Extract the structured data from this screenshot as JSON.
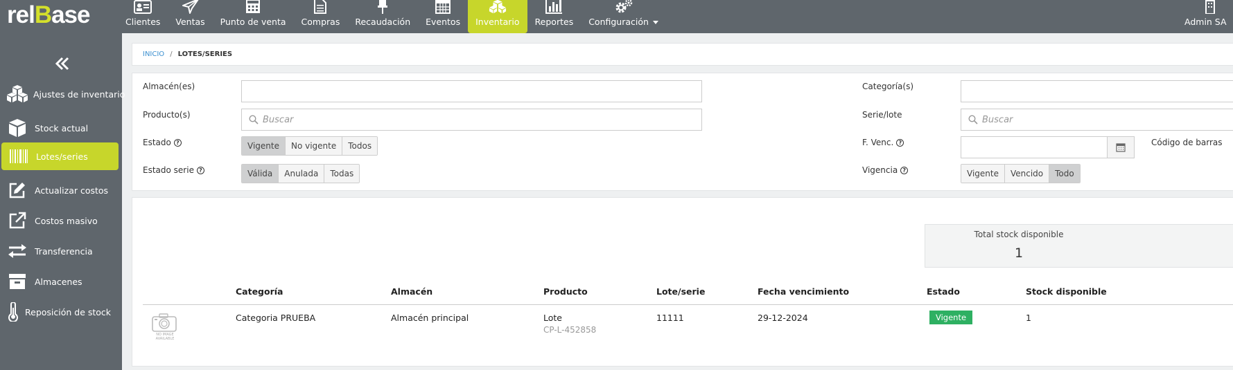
{
  "header": {
    "logo_pre": "rel",
    "logo_accent": "B",
    "logo_post": "ase",
    "nav": [
      {
        "label": "Clientes",
        "icon": "id-card-icon"
      },
      {
        "label": "Ventas",
        "icon": "paper-plane-icon"
      },
      {
        "label": "Punto de venta",
        "icon": "calculator-icon"
      },
      {
        "label": "Compras",
        "icon": "document-icon"
      },
      {
        "label": "Recaudación",
        "icon": "pin-icon"
      },
      {
        "label": "Eventos",
        "icon": "calendar-icon"
      },
      {
        "label": "Inventario",
        "icon": "boxes-icon",
        "active": true
      },
      {
        "label": "Reportes",
        "icon": "bar-chart-icon"
      },
      {
        "label": "Configuración",
        "icon": "gears-icon"
      }
    ],
    "user": "Admin SA"
  },
  "sidebar": {
    "items": [
      {
        "label": "Ajustes de inventario",
        "icon": "cubes-icon"
      },
      {
        "label": "Stock actual",
        "icon": "cube-icon"
      },
      {
        "label": "Lotes/series",
        "icon": "barcode-icon",
        "active": true
      },
      {
        "label": "Actualizar costos",
        "icon": "edit-icon"
      },
      {
        "label": "Costos masivo",
        "icon": "external-link-icon"
      },
      {
        "label": "Transferencia",
        "icon": "exchange-icon"
      },
      {
        "label": "Almacenes",
        "icon": "archive-icon"
      },
      {
        "label": "Reposición de stock",
        "icon": "thermometer-icon"
      }
    ]
  },
  "breadcrumb": {
    "home": "Inicio",
    "separator": "/",
    "current": "Lotes/series"
  },
  "filters": {
    "almacenes_label": "Almacén(es)",
    "categorias_label": "Categoría(s)",
    "productos_label": "Producto(s)",
    "productos_placeholder": "Buscar",
    "serie_label": "Serie/lote",
    "serie_placeholder": "Buscar",
    "estado_label": "Estado",
    "estado_options": [
      "Vigente",
      "No vigente",
      "Todos"
    ],
    "estado_selected": "Vigente",
    "fvenc_label": "F. Venc.",
    "codigo_label": "Código de barras",
    "estado_serie_label": "Estado serie",
    "estado_serie_options": [
      "Válida",
      "Anulada",
      "Todas"
    ],
    "estado_serie_selected": "Válida",
    "vigencia_label": "Vigencia",
    "vigencia_options": [
      "Vigente",
      "Vencido",
      "Todo"
    ],
    "vigencia_selected": "Todo"
  },
  "summary": {
    "total_label": "Total stock disponible",
    "total_value": "1"
  },
  "table": {
    "columns": [
      "Categoría",
      "Almacén",
      "Producto",
      "Lote/serie",
      "Fecha vencimiento",
      "Estado",
      "Stock disponible"
    ],
    "no_image_text": "NO IMAGE AVAILABLE",
    "rows": [
      {
        "categoria": "Categoria PRUEBA",
        "almacen": "Almacén principal",
        "producto": "Lote",
        "producto_code": "CP-L-452858",
        "lote": "11111",
        "fecha": "29-12-2024",
        "estado": "Vigente",
        "stock": "1"
      }
    ]
  },
  "colors": {
    "topbar": "#5f666c",
    "accent": "#c7d62b",
    "logo_accent": "#d4e02b",
    "status_green": "#2eb062",
    "link": "#3a8fd0"
  }
}
